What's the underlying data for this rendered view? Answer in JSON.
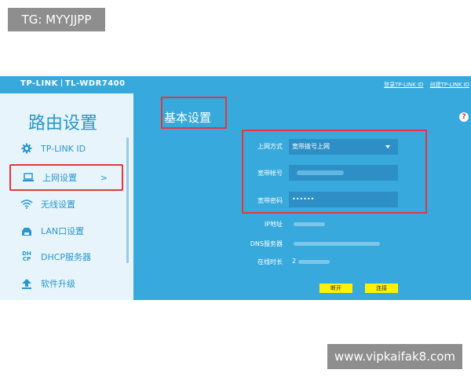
{
  "watermarks": {
    "top": "TG: MYYJJPP",
    "bottom": "www.vipkaifak8.com"
  },
  "header": {
    "brand": "TP-LINK",
    "model": "TL-WDR7400",
    "links": [
      "登录TP-LINK ID",
      "创建TP-LINK ID"
    ]
  },
  "sidebar": {
    "title": "路由设置",
    "items": [
      {
        "label": "TP-LINK ID",
        "icon": "gear-icon"
      },
      {
        "label": "上网设置",
        "icon": "laptop-icon",
        "arrow": ">"
      },
      {
        "label": "无线设置",
        "icon": "wifi-icon"
      },
      {
        "label": "LAN口设置",
        "icon": "lan-icon"
      },
      {
        "label": "DHCP服务器",
        "icon": "dhcp-icon",
        "glyph": "DH\nCP"
      },
      {
        "label": "软件升级",
        "icon": "upload-icon"
      }
    ]
  },
  "main": {
    "title": "基本设置",
    "help": "?",
    "form": {
      "mode_label": "上网方式",
      "mode_value": "宽带拨号上网",
      "account_label": "宽带帐号",
      "password_label": "宽带密码",
      "password_value": "••••••"
    },
    "info": {
      "ip_label": "IP地址",
      "dns_label": "DNS服务器",
      "online_label": "在线时长",
      "online_value": "2"
    },
    "buttons": {
      "disconnect": "断开",
      "connect": "连接"
    }
  },
  "colors": {
    "primary": "#37a9dc",
    "sidebar_bg": "#e7f4fb",
    "accent_text": "#2797cf",
    "highlight": "#e5373b",
    "button": "#fff200"
  }
}
